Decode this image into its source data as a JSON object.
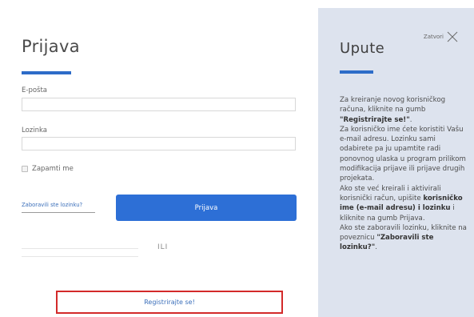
{
  "login": {
    "title": "Prijava",
    "email_label": "E-pošta",
    "email_value": "",
    "password_label": "Lozinka",
    "password_value": "",
    "remember_label": "Zapamti me",
    "forgot_link": "Zaboravili ste lozinku?",
    "login_button": "Prijava",
    "separator_text": "ILI",
    "register_button": "Registrirajte se!"
  },
  "instructions_panel": {
    "close_label": "Zatvori",
    "title": "Upute",
    "line1_a": "Za kreiranje novog korisničkog računa, kliknite na gumb ",
    "line1_b": "\"Registrirajte se!\"",
    "line1_c": ".",
    "line2": "Za korisničko ime ćete koristiti Vašu e-mail adresu. Lozinku sami odabirete pa ju upamtite radi ponovnog ulaska u program prilikom modifikacija prijave ili prijave drugih projekata.",
    "line3_a": "Ako ste već kreirali i aktivirali korisnički račun, upišite ",
    "line3_b": "korisničko ime (e-mail adresu) i lozinku",
    "line3_c": " i kliknite na gumb Prijava.",
    "line4_a": "Ako ste zaboravili lozinku, kliknite na poveznicu ",
    "line4_b": "\"Zaboravili ste lozinku?\"",
    "line4_c": "."
  },
  "colors": {
    "accent": "#2d6fd6",
    "highlight_border": "#d32a2a",
    "panel_background": "#dde3ee"
  }
}
